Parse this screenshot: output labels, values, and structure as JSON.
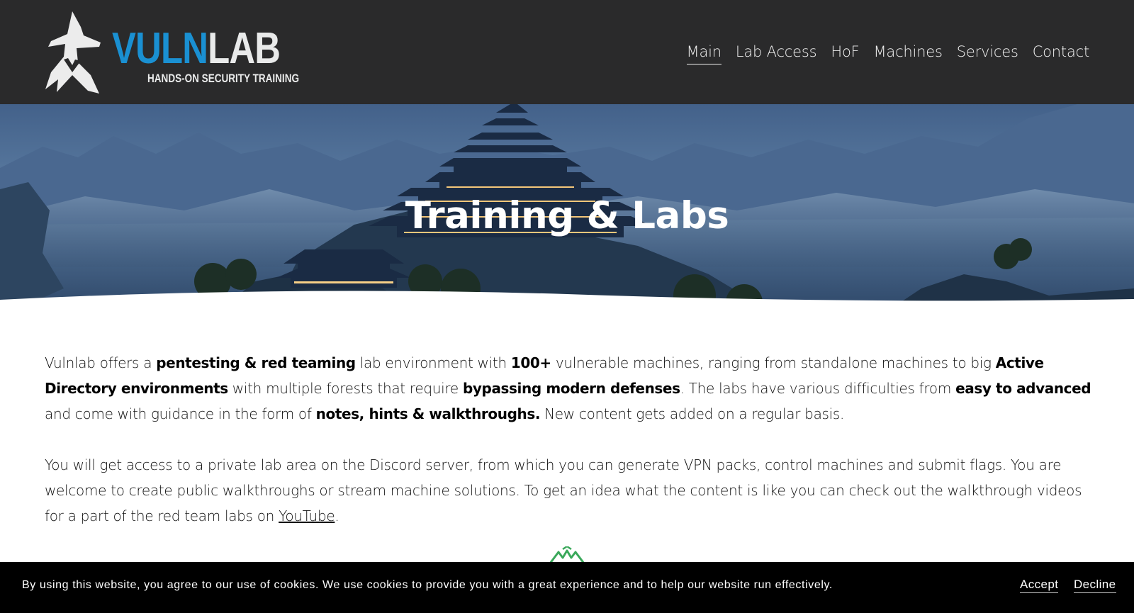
{
  "brand": {
    "name_part1": "VULN",
    "name_part2": "LAB",
    "tagline": "HANDS-ON SECURITY TRAINING",
    "colors": {
      "accent": "#1a90d2",
      "header_bg": "#2a2a2b",
      "logo_text": "#e9eaea"
    }
  },
  "nav": {
    "items": [
      {
        "label": "Main",
        "active": true
      },
      {
        "label": "Lab Access"
      },
      {
        "label": "HoF"
      },
      {
        "label": "Machines"
      },
      {
        "label": "Services"
      },
      {
        "label": "Contact"
      }
    ]
  },
  "hero": {
    "title": "Training & Labs"
  },
  "content": {
    "p1": {
      "t1": "Vulnlab offers a ",
      "b1": "pentesting & red teaming",
      "t2": " lab environment with ",
      "b2": "100+",
      "t3": " vulnerable machines, ranging from standalone machines to big ",
      "b3": "Active Directory environments",
      "t4": " with multiple forests that require ",
      "b4": "bypassing modern defenses",
      "t5": ". The labs have various difficulties from ",
      "b5": "easy to advanced",
      "t6": " and come with guidance in the form of ",
      "b6": "notes, hints & walkthroughs.",
      "t7": " New content gets added on a regular basis."
    },
    "p2": {
      "t1": "You will get access to a private lab area on the Discord server, from which you can generate VPN packs, control machines and submit flags. You are welcome to create public walkthroughs or stream machine solutions. To get an idea what the content is like you can check out the walkthrough videos for a part of the red team labs on ",
      "link": "YouTube",
      "t2": "."
    }
  },
  "cookie_bar": {
    "text": "By using this website, you agree to our use of cookies. We use cookies to provide you with a great experience and to help our website run effectively.",
    "accept_label": "Accept",
    "decline_label": "Decline"
  },
  "icons": {
    "logo_mark": "wizard-hat-icon",
    "peek": "green-mountain-logo-icon"
  }
}
